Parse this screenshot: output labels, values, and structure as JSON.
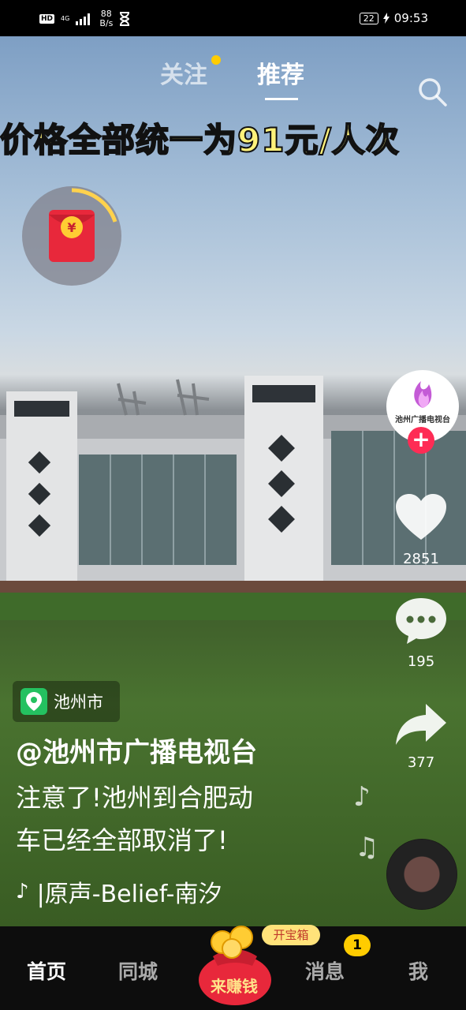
{
  "status_bar": {
    "hd": "HD",
    "network": "4G",
    "speed_value": "88",
    "speed_unit": "B/s",
    "battery": "22",
    "time": "09:53"
  },
  "top_tabs": {
    "follow": "关注",
    "recommend": "推荐"
  },
  "video": {
    "banner_text": "价格全部统一为91元/人次",
    "author_avatar_name": "池州广播电视台",
    "location": "池州市",
    "author": "@池州市广播电视台",
    "description_line1": "注意了!池州到合肥动",
    "description_line2": "车已经全部取消了!",
    "music": "|原声-Belief-南汐"
  },
  "actions": {
    "likes": "2851",
    "comments": "195",
    "shares": "377"
  },
  "bottom_nav": {
    "home": "首页",
    "city": "同城",
    "earn": "来赚钱",
    "treasure": "开宝箱",
    "messages": "消息",
    "messages_badge": "1",
    "me": "我"
  },
  "colors": {
    "accent_red": "#fe2c55",
    "badge_yellow": "#ffcc00",
    "location_green": "#24c160"
  }
}
